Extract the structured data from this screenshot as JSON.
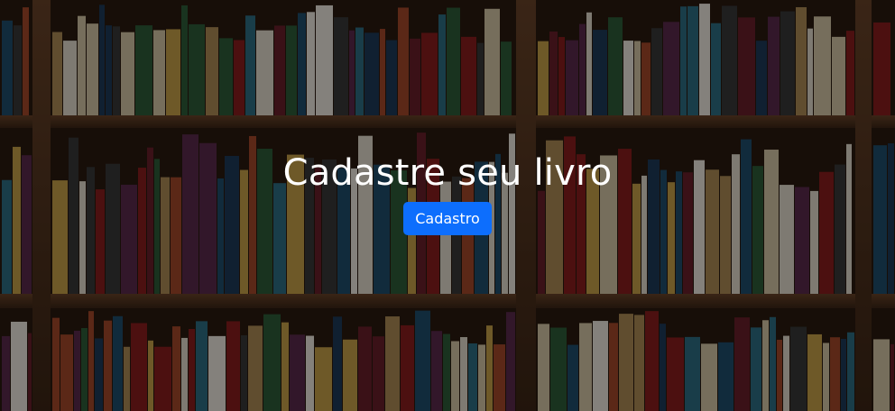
{
  "hero": {
    "title": "Cadastre seu livro",
    "button_label": "Cadastro",
    "background": "bookshelf-photo"
  },
  "colors": {
    "primary_button": "#0d6efd",
    "title_text": "#ffffff",
    "shelf_wood": "#5a3a22"
  }
}
